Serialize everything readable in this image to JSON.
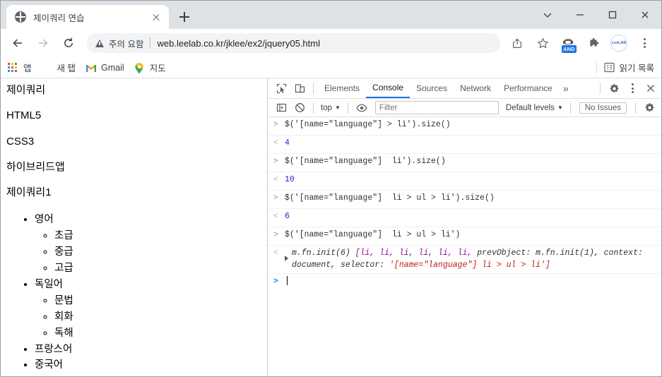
{
  "window": {
    "controls": [
      {
        "name": "chevron-down",
        "label": "⌄"
      },
      {
        "name": "minimize",
        "label": "—"
      },
      {
        "name": "maximize",
        "label": "□"
      },
      {
        "name": "close",
        "label": "✕"
      }
    ]
  },
  "tabs": [
    {
      "title": "제이쿼리 연습",
      "favicon": "globe-icon",
      "active": true
    }
  ],
  "newtab_tooltip": "새 탭",
  "navbar": {
    "back": "back-arrow-icon",
    "forward": "forward-arrow-icon",
    "reload": "reload-icon",
    "security_warning": "주의 요함",
    "url": "web.leelab.co.kr/jklee/ex2/jquery05.html",
    "share": "share-icon",
    "bookmark": "star-icon",
    "extension_badge": "AND",
    "puzzle": "extensions-icon",
    "profile": "LeeLAB",
    "menu": "kebab-menu-icon"
  },
  "bookmarks": {
    "items": [
      {
        "label": "앱",
        "icon": "apps-grid-icon"
      },
      {
        "label": "새 탭",
        "icon": "globe-icon"
      },
      {
        "label": "Gmail",
        "icon": "gmail-icon"
      },
      {
        "label": "지도",
        "icon": "maps-pin-icon"
      }
    ],
    "reading_list": "읽기 목록",
    "reading_list_icon": "reading-list-icon"
  },
  "page": {
    "headings": [
      "제이쿼리",
      "HTML5",
      "CSS3",
      "하이브리드앱",
      "제이쿼리1"
    ],
    "list": [
      {
        "label": "영어",
        "children": [
          "초급",
          "중급",
          "고급"
        ]
      },
      {
        "label": "독일어",
        "children": [
          "문법",
          "회화",
          "독해"
        ]
      },
      {
        "label": "프랑스어",
        "children": []
      },
      {
        "label": "중국어",
        "children": []
      }
    ]
  },
  "devtools": {
    "inspect_icon": "inspect-element-icon",
    "device_icon": "device-toolbar-icon",
    "tabs": [
      {
        "label": "Elements",
        "active": false
      },
      {
        "label": "Console",
        "active": true
      },
      {
        "label": "Sources",
        "active": false
      },
      {
        "label": "Network",
        "active": false
      },
      {
        "label": "Performance",
        "active": false
      }
    ],
    "more_tabs": "»",
    "settings_icon": "gear-icon",
    "kebab_icon": "kebab-menu-icon",
    "close_icon": "close-icon",
    "filterbar": {
      "sidebar_icon": "console-sidebar-icon",
      "clear_icon": "clear-console-icon",
      "context": "top",
      "eye_icon": "live-expression-icon",
      "filter_placeholder": "Filter",
      "filter_value": "",
      "levels": "Default levels",
      "issues": "No Issues",
      "settings_icon": "gear-icon"
    },
    "console_rows": [
      {
        "kind": "input",
        "code": "$('[name=\"language\"] > li').size()"
      },
      {
        "kind": "result",
        "value": "4"
      },
      {
        "kind": "input",
        "code": "$('[name=\"language\"]  li').size()"
      },
      {
        "kind": "result",
        "value": "10"
      },
      {
        "kind": "input",
        "code": "$('[name=\"language\"]  li > ul > li').size()"
      },
      {
        "kind": "result",
        "value": "6"
      },
      {
        "kind": "input",
        "code": "$('[name=\"language\"]  li > ul > li')"
      },
      {
        "kind": "object",
        "head": "m.fn.init(6) ",
        "array": "[li, li, li, li, li, li, ",
        "mid": "prevObject: m.fn.init(1), context: document, selector: ",
        "sel": "'[name=\"language\"]  li > ul > li']"
      },
      {
        "kind": "prompt",
        "value": ""
      }
    ]
  },
  "colors": {
    "chrome_frame": "#dee1e6",
    "accent_blue": "#1a73e8",
    "string_red": "#a31515",
    "result_blue": "#2b1fd6",
    "object_violet": "#881391"
  }
}
